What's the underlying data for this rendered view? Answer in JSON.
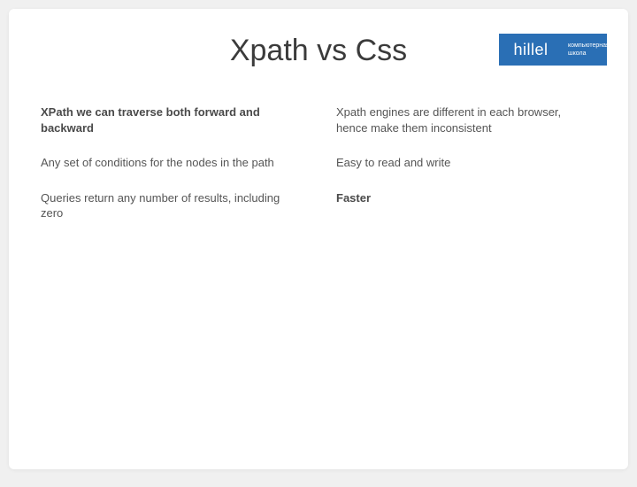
{
  "title": "Xpath vs Css",
  "logo": {
    "main": "hillel",
    "sub_line1": "компьютерная",
    "sub_line2": "школа"
  },
  "left": {
    "item1": "XPath we can traverse both forward and backward",
    "item2": "Any set of conditions for the nodes in the path",
    "item3": "Queries return any number of results, including zero"
  },
  "right": {
    "item1": "Xpath engines are different in each browser, hence make them inconsistent",
    "item2": "Easy to read and write",
    "item3": "Faster"
  }
}
